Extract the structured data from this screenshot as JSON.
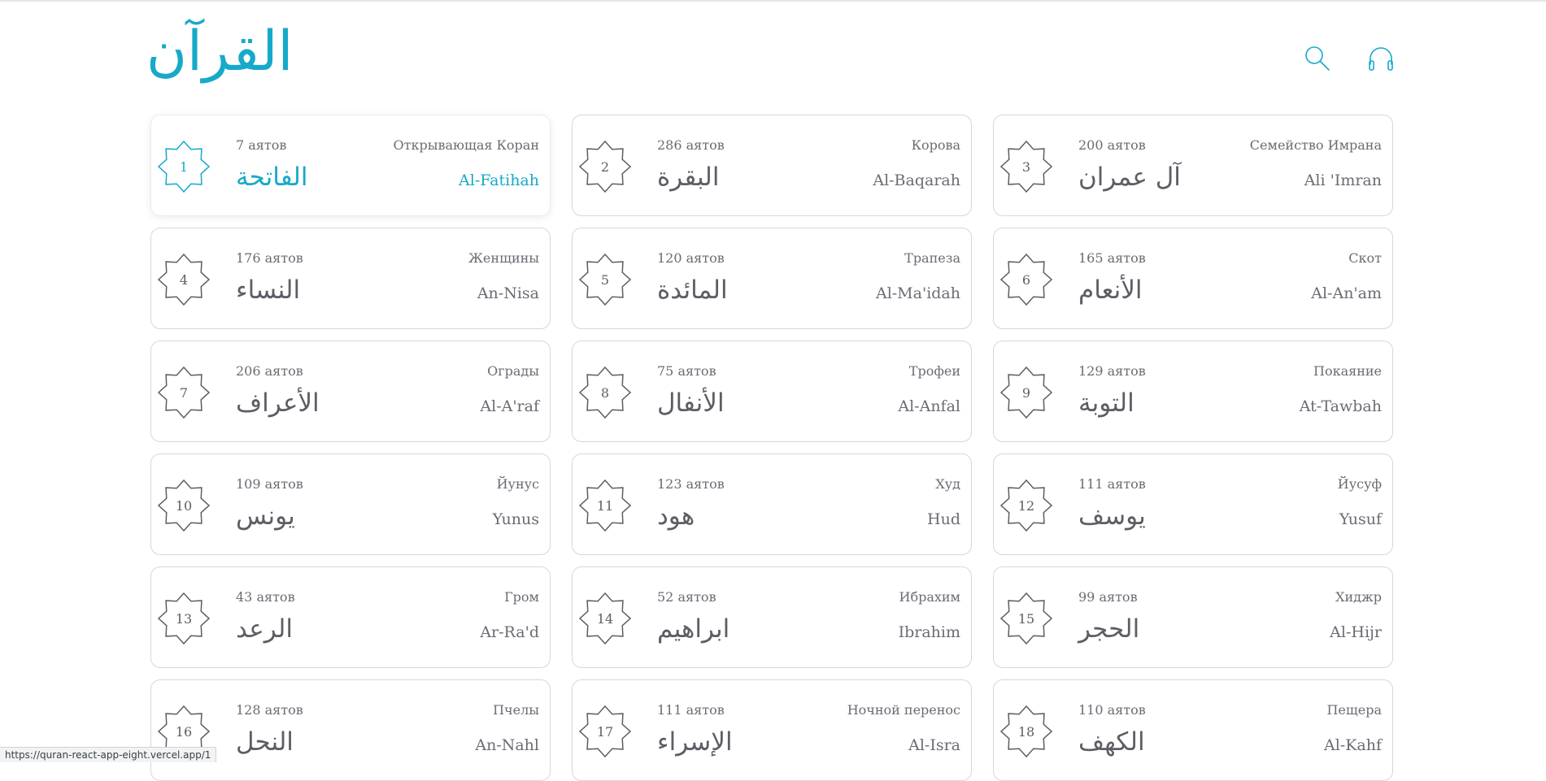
{
  "header": {
    "logo": "القرآن",
    "search_icon": "search-icon",
    "audio_icon": "headphones-icon"
  },
  "colors": {
    "accent": "#17a9c9",
    "text": "#5d5d66",
    "border": "#d7d7dc"
  },
  "surahs": [
    {
      "number": "1",
      "ayahs": "7 аятов",
      "translation": "Открывающая Коран",
      "arabic": "الفاتحة",
      "latin": "Al-Fatihah",
      "active": true
    },
    {
      "number": "2",
      "ayahs": "286 аятов",
      "translation": "Корова",
      "arabic": "البقرة",
      "latin": "Al-Baqarah"
    },
    {
      "number": "3",
      "ayahs": "200 аятов",
      "translation": "Семейство Имрана",
      "arabic": "آل عمران",
      "latin": "Ali 'Imran"
    },
    {
      "number": "4",
      "ayahs": "176 аятов",
      "translation": "Женщины",
      "arabic": "النساء",
      "latin": "An-Nisa"
    },
    {
      "number": "5",
      "ayahs": "120 аятов",
      "translation": "Трапеза",
      "arabic": "المائدة",
      "latin": "Al-Ma'idah"
    },
    {
      "number": "6",
      "ayahs": "165 аятов",
      "translation": "Скот",
      "arabic": "الأنعام",
      "latin": "Al-An'am"
    },
    {
      "number": "7",
      "ayahs": "206 аятов",
      "translation": "Ограды",
      "arabic": "الأعراف",
      "latin": "Al-A'raf"
    },
    {
      "number": "8",
      "ayahs": "75 аятов",
      "translation": "Трофеи",
      "arabic": "الأنفال",
      "latin": "Al-Anfal"
    },
    {
      "number": "9",
      "ayahs": "129 аятов",
      "translation": "Покаяние",
      "arabic": "التوبة",
      "latin": "At-Tawbah"
    },
    {
      "number": "10",
      "ayahs": "109 аятов",
      "translation": "Йунус",
      "arabic": "يونس",
      "latin": "Yunus"
    },
    {
      "number": "11",
      "ayahs": "123 аятов",
      "translation": "Худ",
      "arabic": "هود",
      "latin": "Hud"
    },
    {
      "number": "12",
      "ayahs": "111 аятов",
      "translation": "Йусуф",
      "arabic": "يوسف",
      "latin": "Yusuf"
    },
    {
      "number": "13",
      "ayahs": "43 аятов",
      "translation": "Гром",
      "arabic": "الرعد",
      "latin": "Ar-Ra'd"
    },
    {
      "number": "14",
      "ayahs": "52 аятов",
      "translation": "Ибрахим",
      "arabic": "ابراهيم",
      "latin": "Ibrahim"
    },
    {
      "number": "15",
      "ayahs": "99 аятов",
      "translation": "Хиджр",
      "arabic": "الحجر",
      "latin": "Al-Hijr"
    },
    {
      "number": "16",
      "ayahs": "128 аятов",
      "translation": "Пчелы",
      "arabic": "النحل",
      "latin": "An-Nahl"
    },
    {
      "number": "17",
      "ayahs": "111 аятов",
      "translation": "Ночной перенос",
      "arabic": "الإسراء",
      "latin": "Al-Isra"
    },
    {
      "number": "18",
      "ayahs": "110 аятов",
      "translation": "Пещера",
      "arabic": "الكهف",
      "latin": "Al-Kahf"
    }
  ],
  "status_bar": {
    "url": "https://quran-react-app-eight.vercel.app/1"
  }
}
